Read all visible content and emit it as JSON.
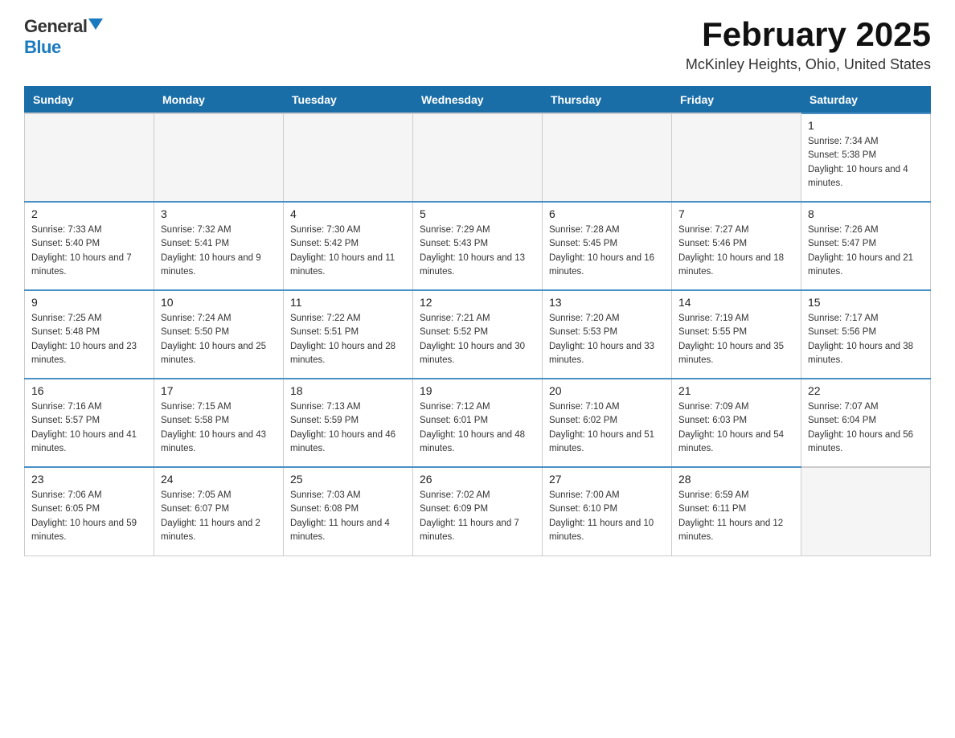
{
  "logo": {
    "general": "General",
    "blue": "Blue"
  },
  "title": "February 2025",
  "subtitle": "McKinley Heights, Ohio, United States",
  "weekdays": [
    "Sunday",
    "Monday",
    "Tuesday",
    "Wednesday",
    "Thursday",
    "Friday",
    "Saturday"
  ],
  "weeks": [
    [
      {
        "day": "",
        "info": ""
      },
      {
        "day": "",
        "info": ""
      },
      {
        "day": "",
        "info": ""
      },
      {
        "day": "",
        "info": ""
      },
      {
        "day": "",
        "info": ""
      },
      {
        "day": "",
        "info": ""
      },
      {
        "day": "1",
        "info": "Sunrise: 7:34 AM\nSunset: 5:38 PM\nDaylight: 10 hours and 4 minutes."
      }
    ],
    [
      {
        "day": "2",
        "info": "Sunrise: 7:33 AM\nSunset: 5:40 PM\nDaylight: 10 hours and 7 minutes."
      },
      {
        "day": "3",
        "info": "Sunrise: 7:32 AM\nSunset: 5:41 PM\nDaylight: 10 hours and 9 minutes."
      },
      {
        "day": "4",
        "info": "Sunrise: 7:30 AM\nSunset: 5:42 PM\nDaylight: 10 hours and 11 minutes."
      },
      {
        "day": "5",
        "info": "Sunrise: 7:29 AM\nSunset: 5:43 PM\nDaylight: 10 hours and 13 minutes."
      },
      {
        "day": "6",
        "info": "Sunrise: 7:28 AM\nSunset: 5:45 PM\nDaylight: 10 hours and 16 minutes."
      },
      {
        "day": "7",
        "info": "Sunrise: 7:27 AM\nSunset: 5:46 PM\nDaylight: 10 hours and 18 minutes."
      },
      {
        "day": "8",
        "info": "Sunrise: 7:26 AM\nSunset: 5:47 PM\nDaylight: 10 hours and 21 minutes."
      }
    ],
    [
      {
        "day": "9",
        "info": "Sunrise: 7:25 AM\nSunset: 5:48 PM\nDaylight: 10 hours and 23 minutes."
      },
      {
        "day": "10",
        "info": "Sunrise: 7:24 AM\nSunset: 5:50 PM\nDaylight: 10 hours and 25 minutes."
      },
      {
        "day": "11",
        "info": "Sunrise: 7:22 AM\nSunset: 5:51 PM\nDaylight: 10 hours and 28 minutes."
      },
      {
        "day": "12",
        "info": "Sunrise: 7:21 AM\nSunset: 5:52 PM\nDaylight: 10 hours and 30 minutes."
      },
      {
        "day": "13",
        "info": "Sunrise: 7:20 AM\nSunset: 5:53 PM\nDaylight: 10 hours and 33 minutes."
      },
      {
        "day": "14",
        "info": "Sunrise: 7:19 AM\nSunset: 5:55 PM\nDaylight: 10 hours and 35 minutes."
      },
      {
        "day": "15",
        "info": "Sunrise: 7:17 AM\nSunset: 5:56 PM\nDaylight: 10 hours and 38 minutes."
      }
    ],
    [
      {
        "day": "16",
        "info": "Sunrise: 7:16 AM\nSunset: 5:57 PM\nDaylight: 10 hours and 41 minutes."
      },
      {
        "day": "17",
        "info": "Sunrise: 7:15 AM\nSunset: 5:58 PM\nDaylight: 10 hours and 43 minutes."
      },
      {
        "day": "18",
        "info": "Sunrise: 7:13 AM\nSunset: 5:59 PM\nDaylight: 10 hours and 46 minutes."
      },
      {
        "day": "19",
        "info": "Sunrise: 7:12 AM\nSunset: 6:01 PM\nDaylight: 10 hours and 48 minutes."
      },
      {
        "day": "20",
        "info": "Sunrise: 7:10 AM\nSunset: 6:02 PM\nDaylight: 10 hours and 51 minutes."
      },
      {
        "day": "21",
        "info": "Sunrise: 7:09 AM\nSunset: 6:03 PM\nDaylight: 10 hours and 54 minutes."
      },
      {
        "day": "22",
        "info": "Sunrise: 7:07 AM\nSunset: 6:04 PM\nDaylight: 10 hours and 56 minutes."
      }
    ],
    [
      {
        "day": "23",
        "info": "Sunrise: 7:06 AM\nSunset: 6:05 PM\nDaylight: 10 hours and 59 minutes."
      },
      {
        "day": "24",
        "info": "Sunrise: 7:05 AM\nSunset: 6:07 PM\nDaylight: 11 hours and 2 minutes."
      },
      {
        "day": "25",
        "info": "Sunrise: 7:03 AM\nSunset: 6:08 PM\nDaylight: 11 hours and 4 minutes."
      },
      {
        "day": "26",
        "info": "Sunrise: 7:02 AM\nSunset: 6:09 PM\nDaylight: 11 hours and 7 minutes."
      },
      {
        "day": "27",
        "info": "Sunrise: 7:00 AM\nSunset: 6:10 PM\nDaylight: 11 hours and 10 minutes."
      },
      {
        "day": "28",
        "info": "Sunrise: 6:59 AM\nSunset: 6:11 PM\nDaylight: 11 hours and 12 minutes."
      },
      {
        "day": "",
        "info": ""
      }
    ]
  ]
}
